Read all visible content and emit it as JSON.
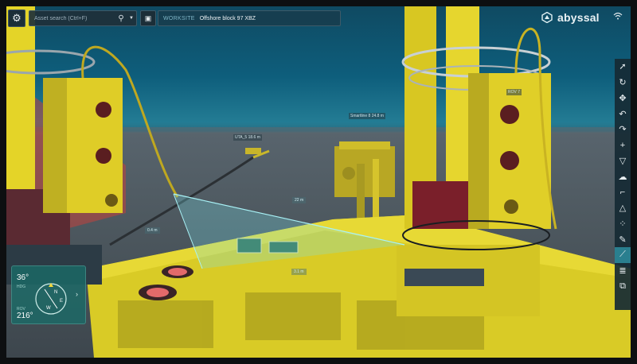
{
  "topbar": {
    "search_placeholder": "Asset search (Ctrl+F)",
    "worksite_label": "WORKSITE",
    "worksite_value": "Offshore block 97 XBZ"
  },
  "brand": {
    "name": "abyssal"
  },
  "icons": {
    "gear": "gear-icon",
    "search": "search-icon",
    "worksite": "worksite-icon",
    "wifi": "wifi-icon"
  },
  "toolbar": {
    "tools": [
      "select-arrow",
      "rotate",
      "move",
      "undo",
      "redo",
      "add",
      "filter",
      "cloud",
      "crane",
      "hoist",
      "measure-points",
      "eraser",
      "ruler",
      "layers",
      "layers-alt"
    ],
    "active_tool": "ruler"
  },
  "compass": {
    "heading_value": "36°",
    "heading_label": "HDG",
    "rov_label": "ROV",
    "rov_value": "216°",
    "letters": {
      "n": "N",
      "e": "E",
      "w": "W"
    }
  },
  "scene_labels": {
    "rov_1": "ROV 7",
    "umbilical": "UTA_5",
    "umbilical_dist": "18.6 m",
    "smartline": "Smartline 8",
    "smartline_dist": "24.8 m",
    "dim_a": "22 m",
    "dim_b": "0.4 m",
    "dim_c": "3.1 m"
  },
  "colors": {
    "water_deep": "#0f4a62",
    "seabed": "#4e5960",
    "structure_yellow": "#e3d22a",
    "accent_teal": "#2a7f8f",
    "measure_cyan": "#7be4ec"
  }
}
